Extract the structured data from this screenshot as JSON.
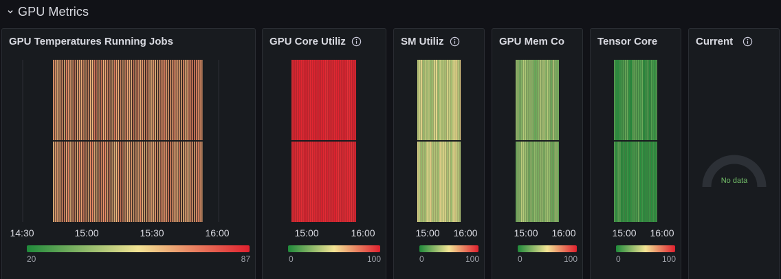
{
  "row": {
    "title": "GPU Metrics",
    "collapse_icon": "chevron-down-icon"
  },
  "colors": {
    "page_bg": "#111217",
    "panel_bg": "#181b1f",
    "panel_border": "#2a2d33",
    "scale_low": "#1f8a3a",
    "scale_mid": "#f2e394",
    "scale_high": "#e0202e",
    "no_data": "#73bf69"
  },
  "panels": [
    {
      "id": "temps",
      "title": "GPU Temperatures Running Jobs",
      "has_info": false,
      "x_ticks": [
        "14:30",
        "15:00",
        "15:30",
        "16:00"
      ],
      "legend": {
        "min": "20",
        "max": "87"
      },
      "chart_data": {
        "type": "heatmap",
        "x_ticks": [
          "14:30",
          "15:00",
          "15:30",
          "16:00"
        ],
        "rows": 2,
        "color_scale": {
          "min": 20,
          "max": 87
        },
        "dominant_value_range": [
          60,
          70
        ]
      }
    },
    {
      "id": "core-util",
      "title": "GPU Core Utiliz",
      "has_info": true,
      "x_ticks": [
        "15:00",
        "16:00"
      ],
      "legend": {
        "min": "0",
        "max": "100"
      },
      "chart_data": {
        "type": "heatmap",
        "x_ticks": [
          "15:00",
          "16:00"
        ],
        "rows": 2,
        "color_scale": {
          "min": 0,
          "max": 100
        },
        "dominant_value_range": [
          95,
          100
        ]
      }
    },
    {
      "id": "sm-util",
      "title": "SM Utiliz",
      "has_info": true,
      "x_ticks": [
        "15:00",
        "16:00"
      ],
      "legend": {
        "min": "0",
        "max": "100"
      },
      "chart_data": {
        "type": "heatmap",
        "x_ticks": [
          "15:00",
          "16:00"
        ],
        "rows": 2,
        "color_scale": {
          "min": 0,
          "max": 100
        },
        "dominant_value_range": [
          25,
          55
        ]
      }
    },
    {
      "id": "mem-copy",
      "title": "GPU Mem Co",
      "has_info": false,
      "x_ticks": [
        "15:00",
        "16:00"
      ],
      "legend": {
        "min": "0",
        "max": "100"
      },
      "chart_data": {
        "type": "heatmap",
        "x_ticks": [
          "15:00",
          "16:00"
        ],
        "rows": 2,
        "color_scale": {
          "min": 0,
          "max": 100
        },
        "dominant_value_range": [
          15,
          40
        ]
      }
    },
    {
      "id": "tensor-core",
      "title": "Tensor Core",
      "has_info": false,
      "x_ticks": [
        "15:00",
        "16:00"
      ],
      "legend": {
        "min": "0",
        "max": "100"
      },
      "chart_data": {
        "type": "heatmap",
        "x_ticks": [
          "15:00",
          "16:00"
        ],
        "rows": 2,
        "color_scale": {
          "min": 0,
          "max": 100
        },
        "dominant_value_range": [
          0,
          20
        ]
      }
    },
    {
      "id": "current",
      "title": "Current",
      "has_info": true,
      "gauge": {
        "status": "No data"
      }
    }
  ]
}
